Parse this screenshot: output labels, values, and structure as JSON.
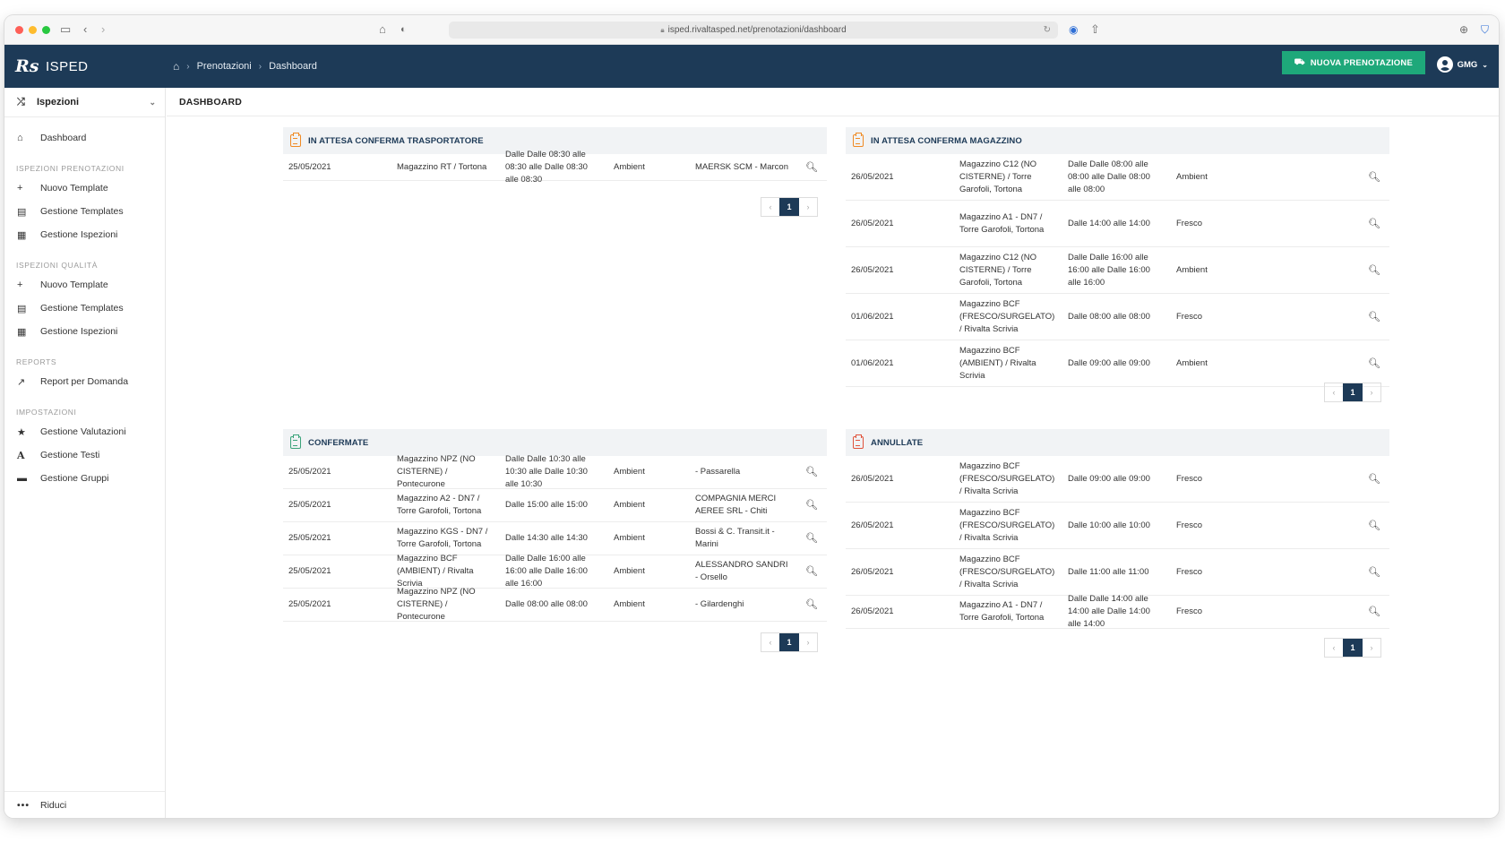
{
  "browser": {
    "url": "isped.rivaltasped.net/prenotazioni/dashboard"
  },
  "app": {
    "logo": "Rs",
    "name": "ISPED"
  },
  "breadcrumb": {
    "items": [
      "Prenotazioni",
      "Dashboard"
    ]
  },
  "header": {
    "new_booking_label": "NUOVA PRENOTAZIONE",
    "user": "GMG"
  },
  "sidebar": {
    "module": "Ispezioni",
    "dashboard": "Dashboard",
    "section_bookings": "ISPEZIONI PRENOTAZIONI",
    "bookings": [
      "Nuovo Template",
      "Gestione Templates",
      "Gestione Ispezioni"
    ],
    "section_quality": "ISPEZIONI QUALITÀ",
    "quality": [
      "Nuovo Template",
      "Gestione Templates",
      "Gestione Ispezioni"
    ],
    "section_reports": "REPORTS",
    "reports": [
      "Report per Domanda"
    ],
    "section_settings": "IMPOSTAZIONI",
    "settings": [
      "Gestione Valutazioni",
      "Gestione Testi",
      "Gestione Gruppi"
    ],
    "collapse": "Riduci"
  },
  "page": {
    "title": "DASHBOARD"
  },
  "panels": {
    "carrier": {
      "title": "IN ATTESA CONFERMA TRASPORTATORE",
      "rows": [
        {
          "date": "25/05/2021",
          "warehouse": "Magazzino RT / Tortona",
          "time": "Dalle Dalle 08:30 alle 08:30 alle Dalle 08:30 alle 08:30",
          "type": "Ambient",
          "carrier": "MAERSK SCM - Marcon"
        }
      ],
      "page": "1"
    },
    "warehouse": {
      "title": "IN ATTESA CONFERMA MAGAZZINO",
      "rows": [
        {
          "date": "26/05/2021",
          "warehouse": "Magazzino C12 (NO CISTERNE) / Torre Garofoli, Tortona",
          "time": "Dalle Dalle 08:00 alle 08:00 alle Dalle 08:00 alle 08:00",
          "type": "Ambient"
        },
        {
          "date": "26/05/2021",
          "warehouse": "Magazzino A1 - DN7 / Torre Garofoli, Tortona",
          "time": "Dalle 14:00 alle 14:00",
          "type": "Fresco"
        },
        {
          "date": "26/05/2021",
          "warehouse": "Magazzino C12 (NO CISTERNE) / Torre Garofoli, Tortona",
          "time": "Dalle Dalle 16:00 alle 16:00 alle Dalle 16:00 alle 16:00",
          "type": "Ambient"
        },
        {
          "date": "01/06/2021",
          "warehouse": "Magazzino BCF (FRESCO/SURGELATO) / Rivalta Scrivia",
          "time": "Dalle 08:00 alle 08:00",
          "type": "Fresco"
        },
        {
          "date": "01/06/2021",
          "warehouse": "Magazzino BCF (AMBIENT) / Rivalta Scrivia",
          "time": "Dalle 09:00 alle 09:00",
          "type": "Ambient"
        }
      ],
      "page": "1"
    },
    "confirmed": {
      "title": "CONFERMATE",
      "rows": [
        {
          "date": "25/05/2021",
          "warehouse": "Magazzino NPZ (NO CISTERNE) / Pontecurone",
          "time": "Dalle Dalle 10:30 alle 10:30 alle Dalle 10:30 alle 10:30",
          "type": "Ambient",
          "carrier": "- Passarella"
        },
        {
          "date": "25/05/2021",
          "warehouse": "Magazzino A2 - DN7 / Torre Garofoli, Tortona",
          "time": "Dalle 15:00 alle 15:00",
          "type": "Ambient",
          "carrier": "COMPAGNIA MERCI AEREE SRL - Chiti"
        },
        {
          "date": "25/05/2021",
          "warehouse": "Magazzino KGS - DN7 / Torre Garofoli, Tortona",
          "time": "Dalle 14:30 alle 14:30",
          "type": "Ambient",
          "carrier": "Bossi & C. Transit.it - Marini"
        },
        {
          "date": "25/05/2021",
          "warehouse": "Magazzino BCF (AMBIENT) / Rivalta Scrivia",
          "time": "Dalle Dalle 16:00 alle 16:00 alle Dalle 16:00 alle 16:00",
          "type": "Ambient",
          "carrier": "ALESSANDRO SANDRI - Orsello"
        },
        {
          "date": "25/05/2021",
          "warehouse": "Magazzino NPZ (NO CISTERNE) / Pontecurone",
          "time": "Dalle 08:00 alle 08:00",
          "type": "Ambient",
          "carrier": "- Gilardenghi"
        }
      ],
      "page": "1"
    },
    "cancelled": {
      "title": "ANNULLATE",
      "rows": [
        {
          "date": "26/05/2021",
          "warehouse": "Magazzino BCF (FRESCO/SURGELATO) / Rivalta Scrivia",
          "time": "Dalle 09:00 alle 09:00",
          "type": "Fresco"
        },
        {
          "date": "26/05/2021",
          "warehouse": "Magazzino BCF (FRESCO/SURGELATO) / Rivalta Scrivia",
          "time": "Dalle 10:00 alle 10:00",
          "type": "Fresco"
        },
        {
          "date": "26/05/2021",
          "warehouse": "Magazzino BCF (FRESCO/SURGELATO) / Rivalta Scrivia",
          "time": "Dalle 11:00 alle 11:00",
          "type": "Fresco"
        },
        {
          "date": "26/05/2021",
          "warehouse": "Magazzino A1 - DN7 / Torre Garofoli, Tortona",
          "time": "Dalle Dalle 14:00 alle 14:00 alle Dalle 14:00 alle 14:00",
          "type": "Fresco"
        }
      ],
      "page": "1"
    }
  },
  "colors": {
    "navy": "#1d3a57",
    "green": "#1ea87a",
    "orange": "#f08a24",
    "red": "#e0533c"
  }
}
